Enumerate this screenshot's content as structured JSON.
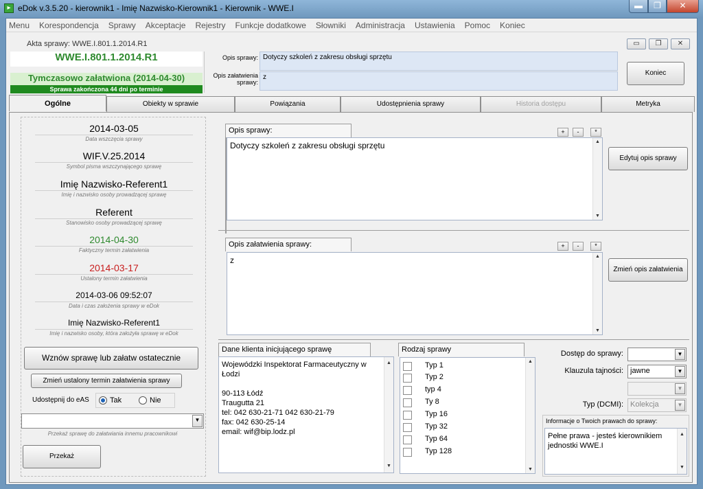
{
  "window": {
    "title": "eDok v.3.5.20 - kierownik1 - Imię Nazwisko-Kierownik1 - Kierownik - WWE.I",
    "minimize_glyph": "▬",
    "maximize_glyph": "❐",
    "close_glyph": "✕"
  },
  "menu": [
    "Menu",
    "Korespondencja",
    "Sprawy",
    "Akceptacje",
    "Rejestry",
    "Funkcje dodatkowe",
    "Słowniki",
    "Administracja",
    "Ustawienia",
    "Pomoc",
    "Koniec"
  ],
  "child": {
    "title": "Akta sprawy: WWE.I.801.1.2014.R1",
    "minimize_glyph": "▭",
    "restore_glyph": "❐",
    "close_glyph": "✕"
  },
  "header": {
    "signature": "WWE.I.801.1.2014.R1",
    "status": "Tymczasowo załatwiona (2014-04-30)",
    "status_note": "Sprawa zakończona 44 dni po terminie",
    "opis_label": "Opis sprawy:",
    "opis_value": "Dotyczy szkoleń z zakresu obsługi sprzętu",
    "zalatwienie_label": "Opis załatwienia sprawy:",
    "zalatwienie_value": "z",
    "end_button": "Koniec"
  },
  "tabs": [
    {
      "label": "Ogólne",
      "state": "active"
    },
    {
      "label": "Obiekty w sprawie",
      "state": "normal"
    },
    {
      "label": "Powiązania",
      "state": "normal"
    },
    {
      "label": "Udostępnienia sprawy",
      "state": "normal"
    },
    {
      "label": "Historia dostępu",
      "state": "disabled"
    },
    {
      "label": "Metryka",
      "state": "normal"
    }
  ],
  "info": [
    {
      "value": "2014-03-05",
      "label": "Data wszczęcia sprawy",
      "color": "#000000"
    },
    {
      "value": "WIF.V.25.2014",
      "label": "Symbol pisma wszczynającego sprawę",
      "color": "#000000"
    },
    {
      "value": "Imię Nazwisko-Referent1",
      "label": "Imię i nazwisko osoby prowadzącej sprawę",
      "color": "#000000"
    },
    {
      "value": "Referent",
      "label": "Stanowisko osoby prowadzącej sprawę",
      "color": "#000000"
    },
    {
      "value": "2014-04-30",
      "label": "Faktyczny termin załatwienia",
      "color": "#2f8a2f"
    },
    {
      "value": "2014-03-17",
      "label": "Ustalony termin załatwienia",
      "color": "#c81e1e"
    },
    {
      "value": "2014-03-06 09:52:07",
      "label": "Data i czas założenia sprawy w eDok",
      "color": "#000000"
    },
    {
      "value": "Imię Nazwisko-Referent1",
      "label": "Imię i nazwisko osoby, która założyła sprawę w eDok",
      "color": "#000000"
    }
  ],
  "left_actions": {
    "resume_button": "Wznów sprawę lub załatw ostatecznie",
    "change_term_button": "Zmień ustalony termin załatwienia sprawy",
    "share_label": "Udostępnij do eAS",
    "share_yes": "Tak",
    "share_no": "Nie",
    "share_selected": "Tak",
    "transfer_combo_value": "",
    "transfer_hint": "Przekaż sprawę do załatwiania innemu pracownikowi",
    "transfer_button": "Przekaż"
  },
  "opis_sprawy": {
    "title": "Opis sprawy:",
    "text": "Dotyczy szkoleń z zakresu obsługi sprzętu",
    "edit_button": "Edytuj opis sprawy"
  },
  "opis_zalatwienia": {
    "title": "Opis załatwienia sprawy:",
    "text": "z",
    "edit_button": "Zmień opis załatwienia"
  },
  "zoom_buttons": [
    "+",
    "-",
    "*"
  ],
  "client": {
    "title": "Dane klienta inicjującego sprawę",
    "lines": [
      "Wojewódzki Inspektorat Farmaceutyczny w Łodzi",
      "",
      "90-113 Łódź",
      "Traugutta 21",
      "tel: 042 630-21-71 042 630-21-79",
      "fax: 042 630-25-14",
      "email: wif@bip.lodz.pl"
    ]
  },
  "rodzaj": {
    "title": "Rodzaj sprawy",
    "items": [
      "Typ 1",
      "Typ 2",
      "typ 4",
      "Ty 8",
      "Typ 16",
      "Typ 32",
      "Typ 64",
      "Typ 128"
    ]
  },
  "access": {
    "dostep_label": "Dostęp do sprawy:",
    "dostep_value": "",
    "klauzula_label": "Klauzula tajności:",
    "klauzula_value": "jawne",
    "extra_value": "",
    "typ_label": "Typ (DCMI):",
    "typ_value": "Kolekcja",
    "info_title": "Informacje o Twoich prawach do sprawy:",
    "info_text": "Pełne prawa - jesteś kierownikiem jednostki WWE.I"
  }
}
